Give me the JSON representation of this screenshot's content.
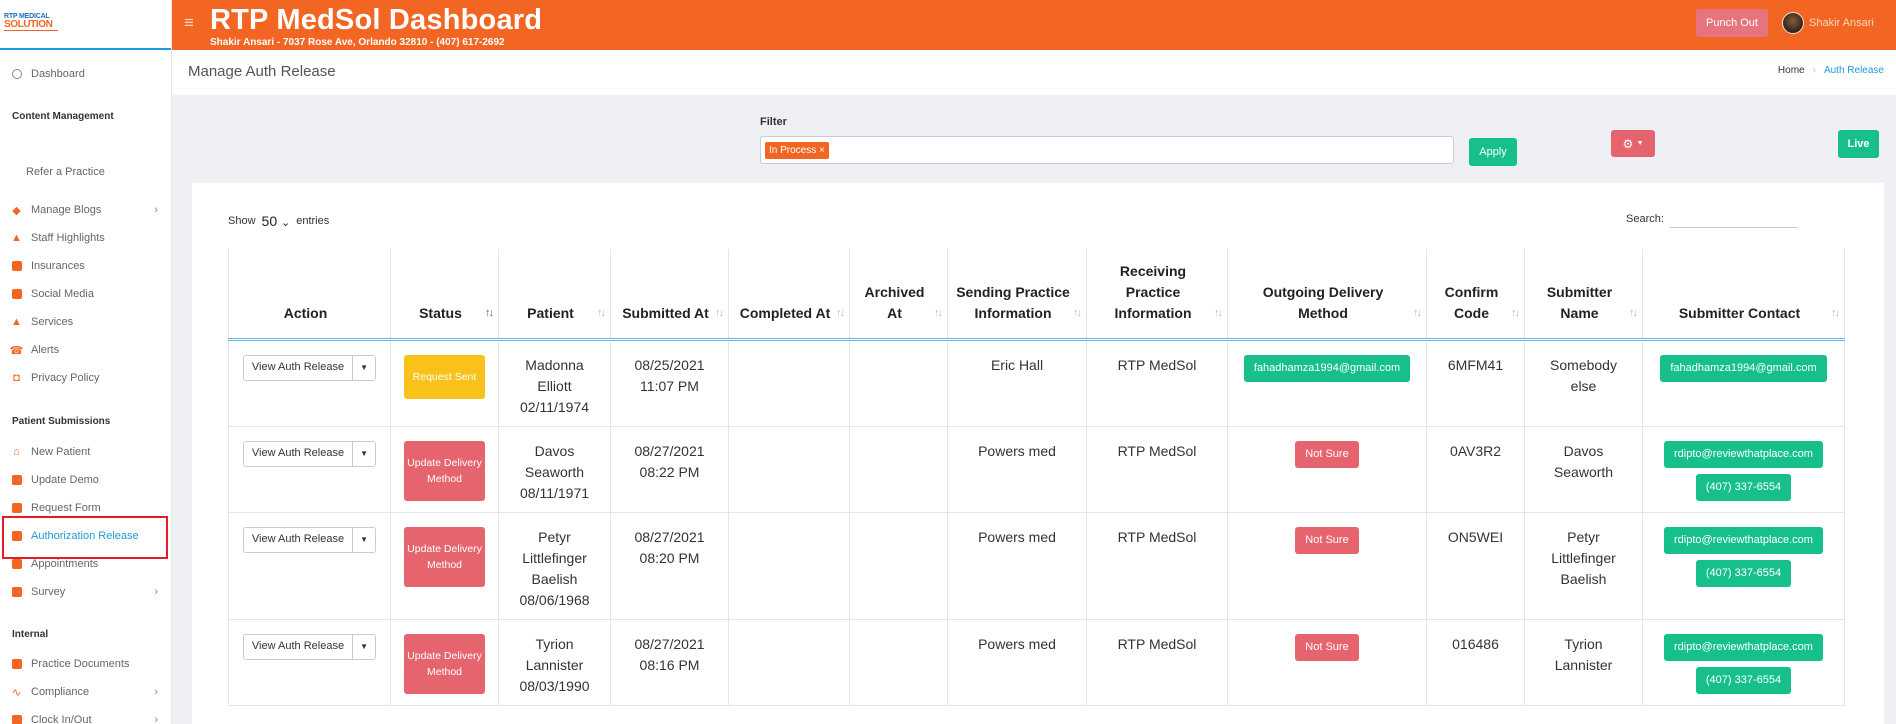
{
  "logo": {
    "line1": "RTP MEDICAL",
    "line2": "SOLUTION"
  },
  "header": {
    "title": "RTP MedSol Dashboard",
    "subtitle": "Shakir Ansari - 7037 Rose Ave, Orlando 32810 - (407) 617-2692",
    "punch_out": "Punch Out",
    "user_name": "Shakir Ansari"
  },
  "sidebar": {
    "dashboard": "Dashboard",
    "section_content": "Content Management",
    "refer": "Refer a Practice",
    "manage_blogs": "Manage Blogs",
    "staff_highlights": "Staff Highlights",
    "insurances": "Insurances",
    "social_media": "Social Media",
    "services": "Services",
    "alerts": "Alerts",
    "privacy_policy": "Privacy Policy",
    "section_patient": "Patient Submissions",
    "new_patient": "New Patient",
    "update_demo": "Update Demo",
    "request_form": "Request Form",
    "authorization_release": "Authorization Release",
    "appointments": "Appointments",
    "survey": "Survey",
    "section_internal": "Internal",
    "practice_documents": "Practice Documents",
    "compliance": "Compliance",
    "clock": "Clock In/Out"
  },
  "page": {
    "title": "Manage Auth Release",
    "breadcrumb_home": "Home",
    "breadcrumb_current": "Auth Release"
  },
  "filter": {
    "label": "Filter",
    "tag": "In Process",
    "apply": "Apply",
    "live": "Live"
  },
  "table_controls": {
    "show": "Show",
    "entries_value": "50",
    "entries": "entries",
    "search": "Search:"
  },
  "columns": [
    "Action",
    "Status",
    "Patient",
    "Submitted At",
    "Completed At",
    "Archived At",
    "Sending Practice Information",
    "Receiving Practice Information",
    "Outgoing Delivery Method",
    "Confirm Code",
    "Submitter Name",
    "Submitter Contact"
  ],
  "action_label": "View Auth Release",
  "rows": [
    {
      "status": "Request Sent",
      "status_color": "#f9c21a",
      "patient": [
        "Madonna",
        "Elliott",
        "02/11/1974"
      ],
      "submitted": [
        "08/25/2021",
        "11:07 PM"
      ],
      "completed": "",
      "archived": "",
      "sending": "Eric Hall",
      "receiving": "RTP MedSol",
      "delivery": "fahadhamza1994@gmail.com",
      "delivery_color": "#17c08a",
      "code": "6MFM41",
      "submitter": [
        "Somebody",
        "else"
      ],
      "contact": [
        "fahadhamza1994@gmail.com"
      ]
    },
    {
      "status": "Update Delivery Method",
      "status_color": "#e5646e",
      "patient": [
        "Davos",
        "Seaworth",
        "08/11/1971"
      ],
      "submitted": [
        "08/27/2021",
        "08:22 PM"
      ],
      "completed": "",
      "archived": "",
      "sending": "Powers med",
      "receiving": "RTP MedSol",
      "delivery": "Not Sure",
      "delivery_color": "#e5646e",
      "code": "0AV3R2",
      "submitter": [
        "Davos",
        "Seaworth"
      ],
      "contact": [
        "rdipto@reviewthatplace.com",
        "(407) 337-6554"
      ]
    },
    {
      "status": "Update Delivery Method",
      "status_color": "#e5646e",
      "patient": [
        "Petyr",
        "Littlefinger",
        "Baelish",
        "08/06/1968"
      ],
      "submitted": [
        "08/27/2021",
        "08:20 PM"
      ],
      "completed": "",
      "archived": "",
      "sending": "Powers med",
      "receiving": "RTP MedSol",
      "delivery": "Not Sure",
      "delivery_color": "#e5646e",
      "code": "ON5WEI",
      "submitter": [
        "Petyr",
        "Littlefinger",
        "Baelish"
      ],
      "contact": [
        "rdipto@reviewthatplace.com",
        "(407) 337-6554"
      ]
    },
    {
      "status": "Update Delivery Method",
      "status_color": "#e5646e",
      "patient": [
        "Tyrion",
        "Lannister",
        "08/03/1990"
      ],
      "submitted": [
        "08/27/2021",
        "08:16 PM"
      ],
      "completed": "",
      "archived": "",
      "sending": "Powers med",
      "receiving": "RTP MedSol",
      "delivery": "Not Sure",
      "delivery_color": "#e5646e",
      "code": "016486",
      "submitter": [
        "Tyrion",
        "Lannister"
      ],
      "contact": [
        "rdipto@reviewthatplace.com",
        "(407) 337-6554"
      ]
    }
  ]
}
